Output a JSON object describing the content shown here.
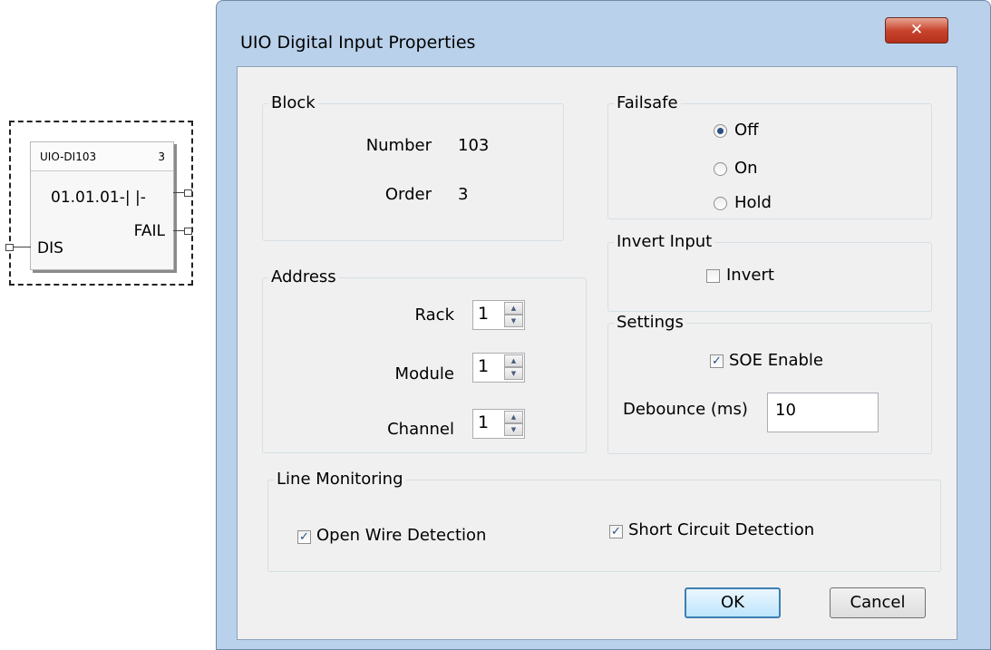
{
  "function_block": {
    "name": "UIO-DI103",
    "order": "3",
    "address": "01.01.01-| |-",
    "fail_label": "FAIL",
    "dis_label": "DIS"
  },
  "dialog": {
    "title": "UIO Digital Input Properties",
    "close_icon": "x-icon",
    "block": {
      "label": "Block",
      "number_label": "Number",
      "number_value": "103",
      "order_label": "Order",
      "order_value": "3"
    },
    "address": {
      "label": "Address",
      "rack_label": "Rack",
      "rack_value": "1",
      "module_label": "Module",
      "module_value": "1",
      "channel_label": "Channel",
      "channel_value": "1"
    },
    "failsafe": {
      "label": "Failsafe",
      "options": [
        "Off",
        "On",
        "Hold"
      ],
      "selected": "Off"
    },
    "invert_input": {
      "label": "Invert Input",
      "invert_label": "Invert",
      "invert_checked": false
    },
    "settings": {
      "label": "Settings",
      "soe_label": "SOE Enable",
      "soe_checked": true,
      "debounce_label": "Debounce (ms)",
      "debounce_value": "10"
    },
    "line_monitoring": {
      "label": "Line Monitoring",
      "open_wire_label": "Open Wire Detection",
      "open_wire_checked": true,
      "short_circuit_label": "Short Circuit Detection",
      "short_circuit_checked": true
    },
    "buttons": {
      "ok": "OK",
      "cancel": "Cancel"
    },
    "accent_color": "#3c7fb1",
    "title_bar_color": "#b9d1ea"
  }
}
